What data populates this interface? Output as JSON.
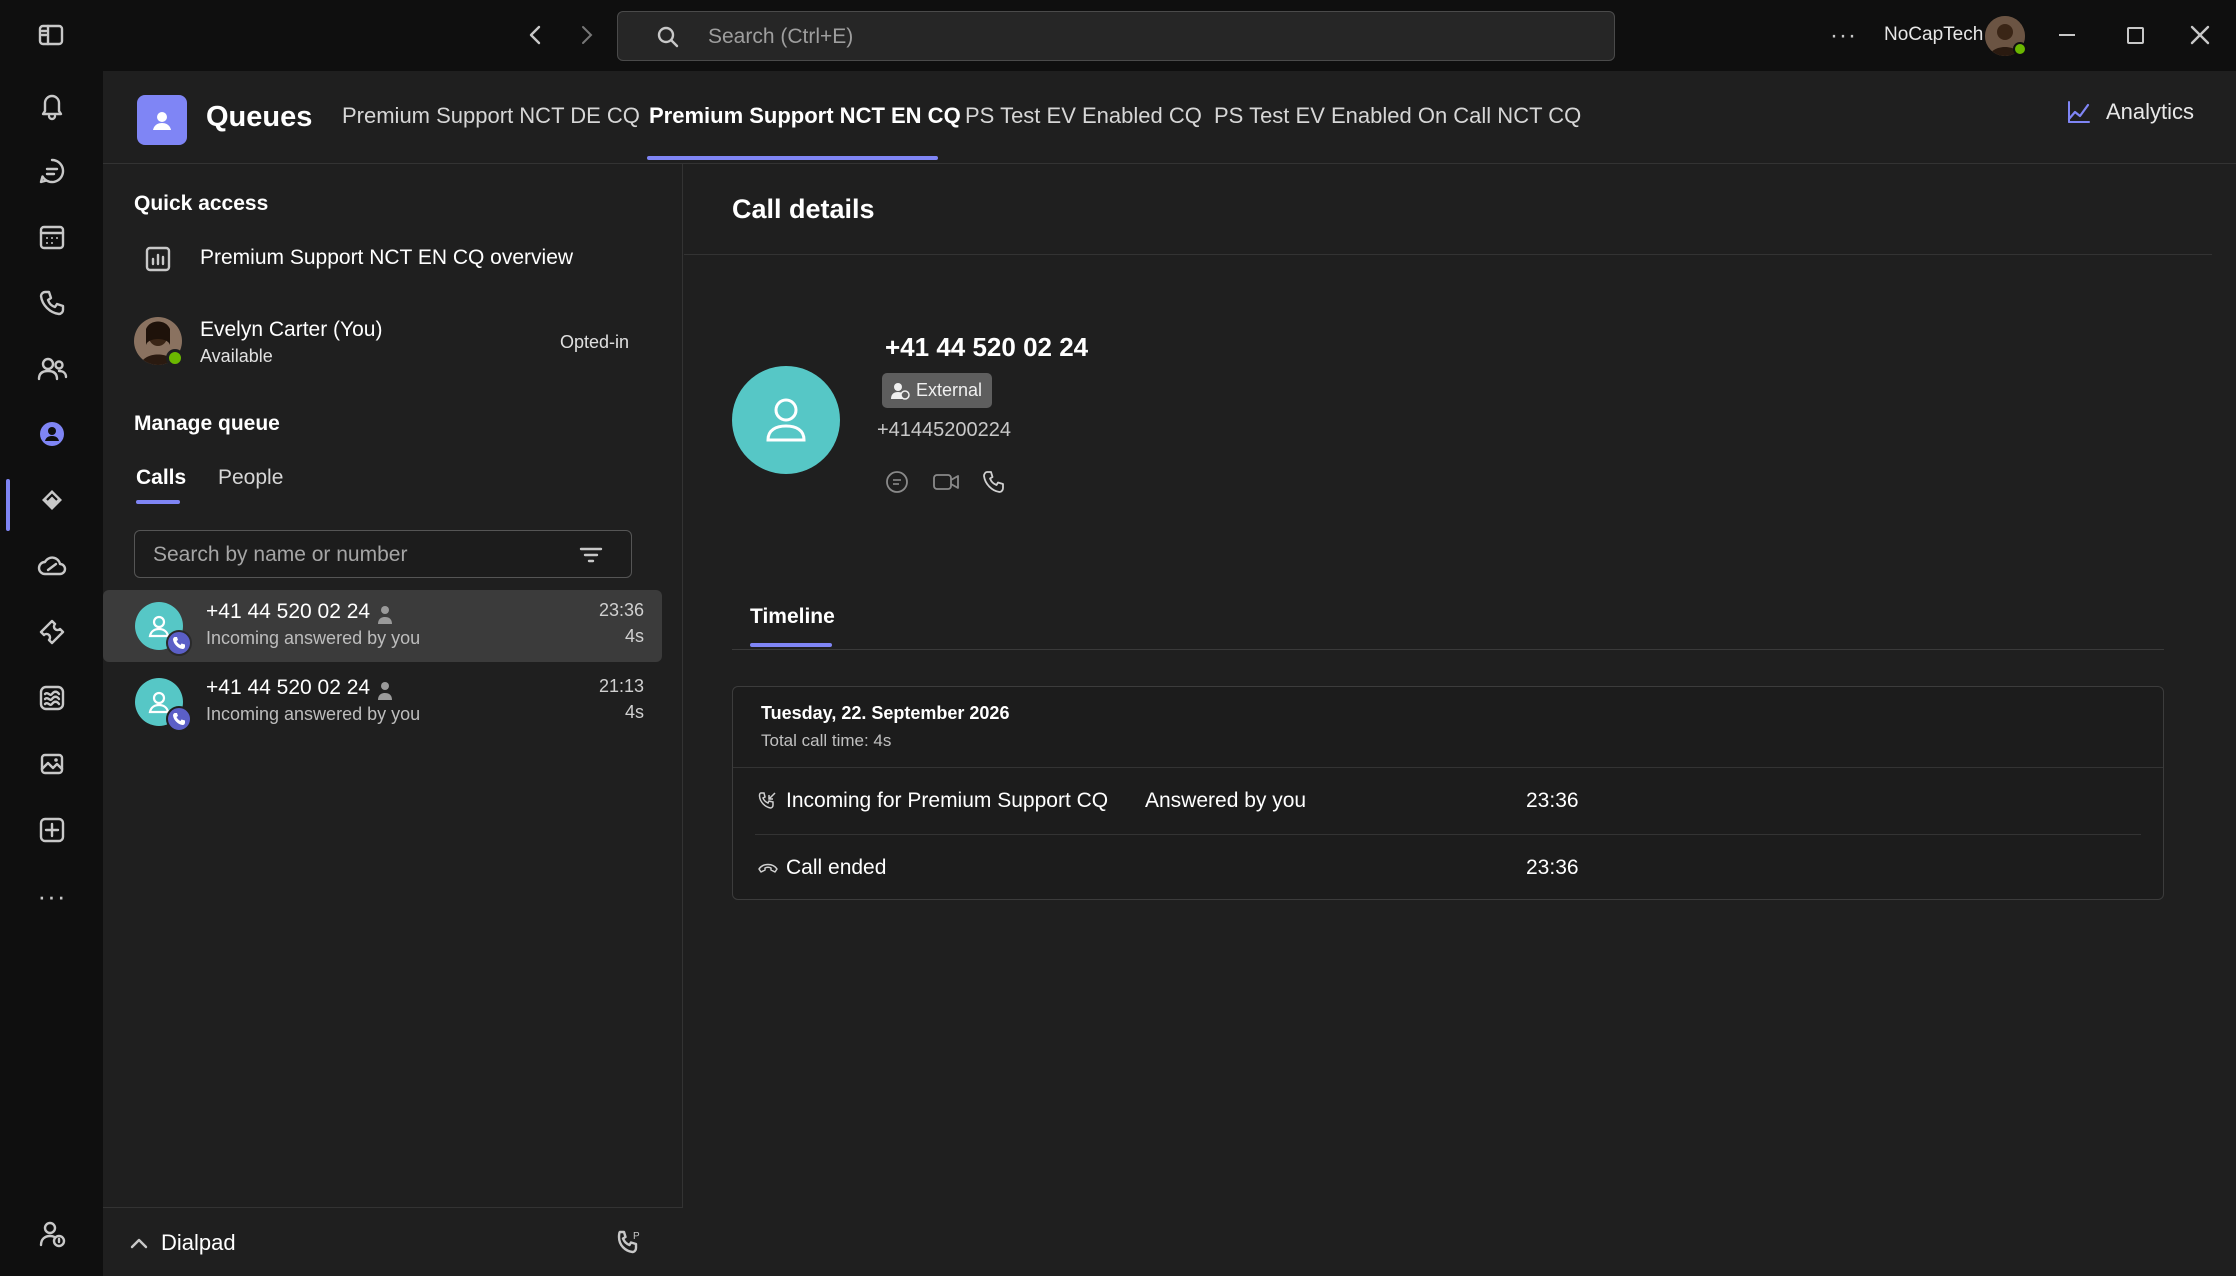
{
  "titlebar": {
    "search_placeholder": "Search (Ctrl+E)",
    "account_name": "NoCapTech"
  },
  "app": {
    "title": "Queues",
    "tabs": [
      {
        "label": "Premium Support NCT DE CQ",
        "active": false
      },
      {
        "label": "Premium Support NCT EN CQ",
        "active": true
      },
      {
        "label": "PS Test EV Enabled CQ",
        "active": false
      },
      {
        "label": "PS Test EV Enabled On Call NCT CQ",
        "active": false
      }
    ],
    "analytics_label": "Analytics"
  },
  "left_panel": {
    "quick_access_title": "Quick access",
    "overview_label": "Premium Support NCT EN CQ overview",
    "agent": {
      "name": "Evelyn Carter (You)",
      "status": "Available",
      "opt_state": "Opted-in"
    },
    "manage_queue_title": "Manage queue",
    "subtabs": [
      {
        "label": "Calls",
        "active": true
      },
      {
        "label": "People",
        "active": false
      }
    ],
    "search_placeholder": "Search by name or number",
    "calls": [
      {
        "number": "+41 44 520 02 24",
        "status": "Incoming answered by you",
        "time": "23:36",
        "duration": "4s",
        "selected": true
      },
      {
        "number": "+41 44 520 02 24",
        "status": "Incoming answered by you",
        "time": "21:13",
        "duration": "4s",
        "selected": false
      }
    ],
    "dialpad_label": "Dialpad"
  },
  "details": {
    "title": "Call details",
    "contact_name": "+41 44 520 02 24",
    "badge": "External",
    "contact_number": "+41445200224",
    "timeline_tab": "Timeline",
    "timeline": {
      "date": "Tuesday, 22. September 2026",
      "total": "Total call time: 4s",
      "events": [
        {
          "label": "Incoming for Premium Support CQ",
          "detail": "Answered by you",
          "time": "23:36"
        },
        {
          "label": "Call ended",
          "detail": "",
          "time": "23:36"
        }
      ]
    }
  },
  "colors": {
    "accent": "#7f85f5",
    "avatar": "#56c7c6",
    "background": "#1f1f1f",
    "rail": "#0f0f0f"
  }
}
